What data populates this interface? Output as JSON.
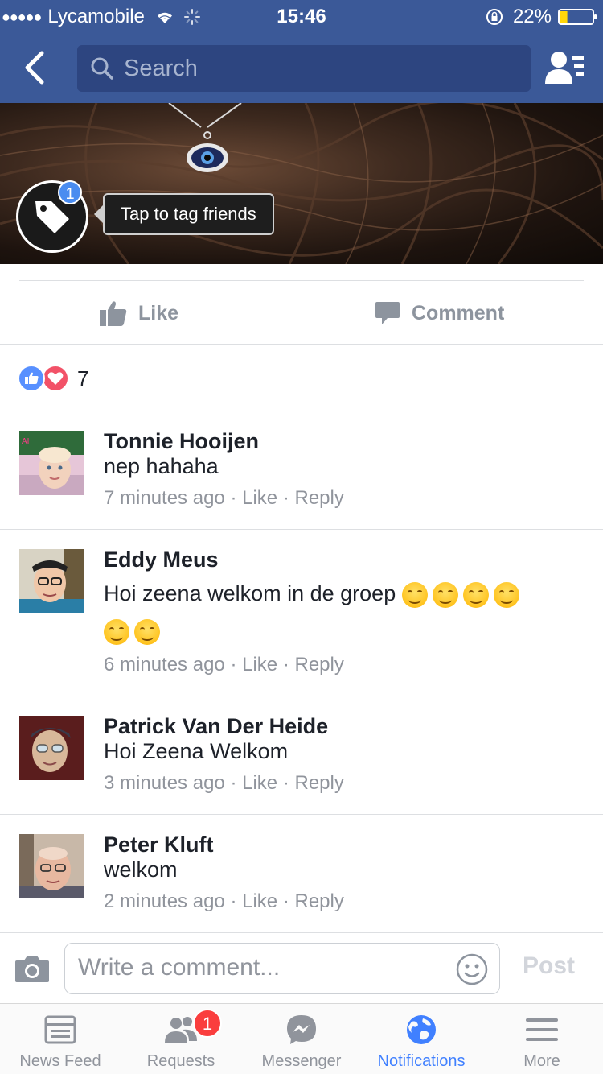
{
  "status_bar": {
    "signal_dots": "●●●●●",
    "carrier": "Lycamobile",
    "time": "15:46",
    "battery_percent": "22%",
    "battery_level": 0.22
  },
  "nav": {
    "search_placeholder": "Search"
  },
  "photo": {
    "tag_badge_count": "1",
    "tag_tooltip": "Tap to tag friends"
  },
  "actions": {
    "like_label": "Like",
    "comment_label": "Comment"
  },
  "reactions": {
    "count": "7"
  },
  "comments": [
    {
      "name": "Tonnie Hooijen",
      "text": "nep hahaha",
      "time": "7 minutes ago",
      "like": "Like",
      "reply": "Reply",
      "sep": "·"
    },
    {
      "name": "Eddy Meus",
      "text": "Hoi zeena welkom in de groep",
      "emoji_count_line1": 4,
      "emoji_count_line2": 2,
      "time": "6 minutes ago",
      "like": "Like",
      "reply": "Reply",
      "sep": "·"
    },
    {
      "name": "Patrick Van Der Heide",
      "text": "Hoi Zeena Welkom",
      "time": "3 minutes ago",
      "like": "Like",
      "reply": "Reply",
      "sep": "·"
    },
    {
      "name": "Peter Kluft",
      "text": "welkom",
      "time": "2 minutes ago",
      "like": "Like",
      "reply": "Reply",
      "sep": "·"
    }
  ],
  "composer": {
    "placeholder": "Write a comment...",
    "post_label": "Post"
  },
  "tabbar": {
    "tabs": [
      {
        "label": "News Feed",
        "icon": "news-feed-icon"
      },
      {
        "label": "Requests",
        "icon": "requests-icon",
        "badge": "1"
      },
      {
        "label": "Messenger",
        "icon": "messenger-icon"
      },
      {
        "label": "Notifications",
        "icon": "globe-icon",
        "active": true
      },
      {
        "label": "More",
        "icon": "menu-icon"
      }
    ]
  },
  "colors": {
    "brand_blue": "#3b5998",
    "active_tab": "#4080ff",
    "badge_red": "#fa3e3e",
    "like_reaction": "#5890ff",
    "love_reaction": "#f25268"
  }
}
